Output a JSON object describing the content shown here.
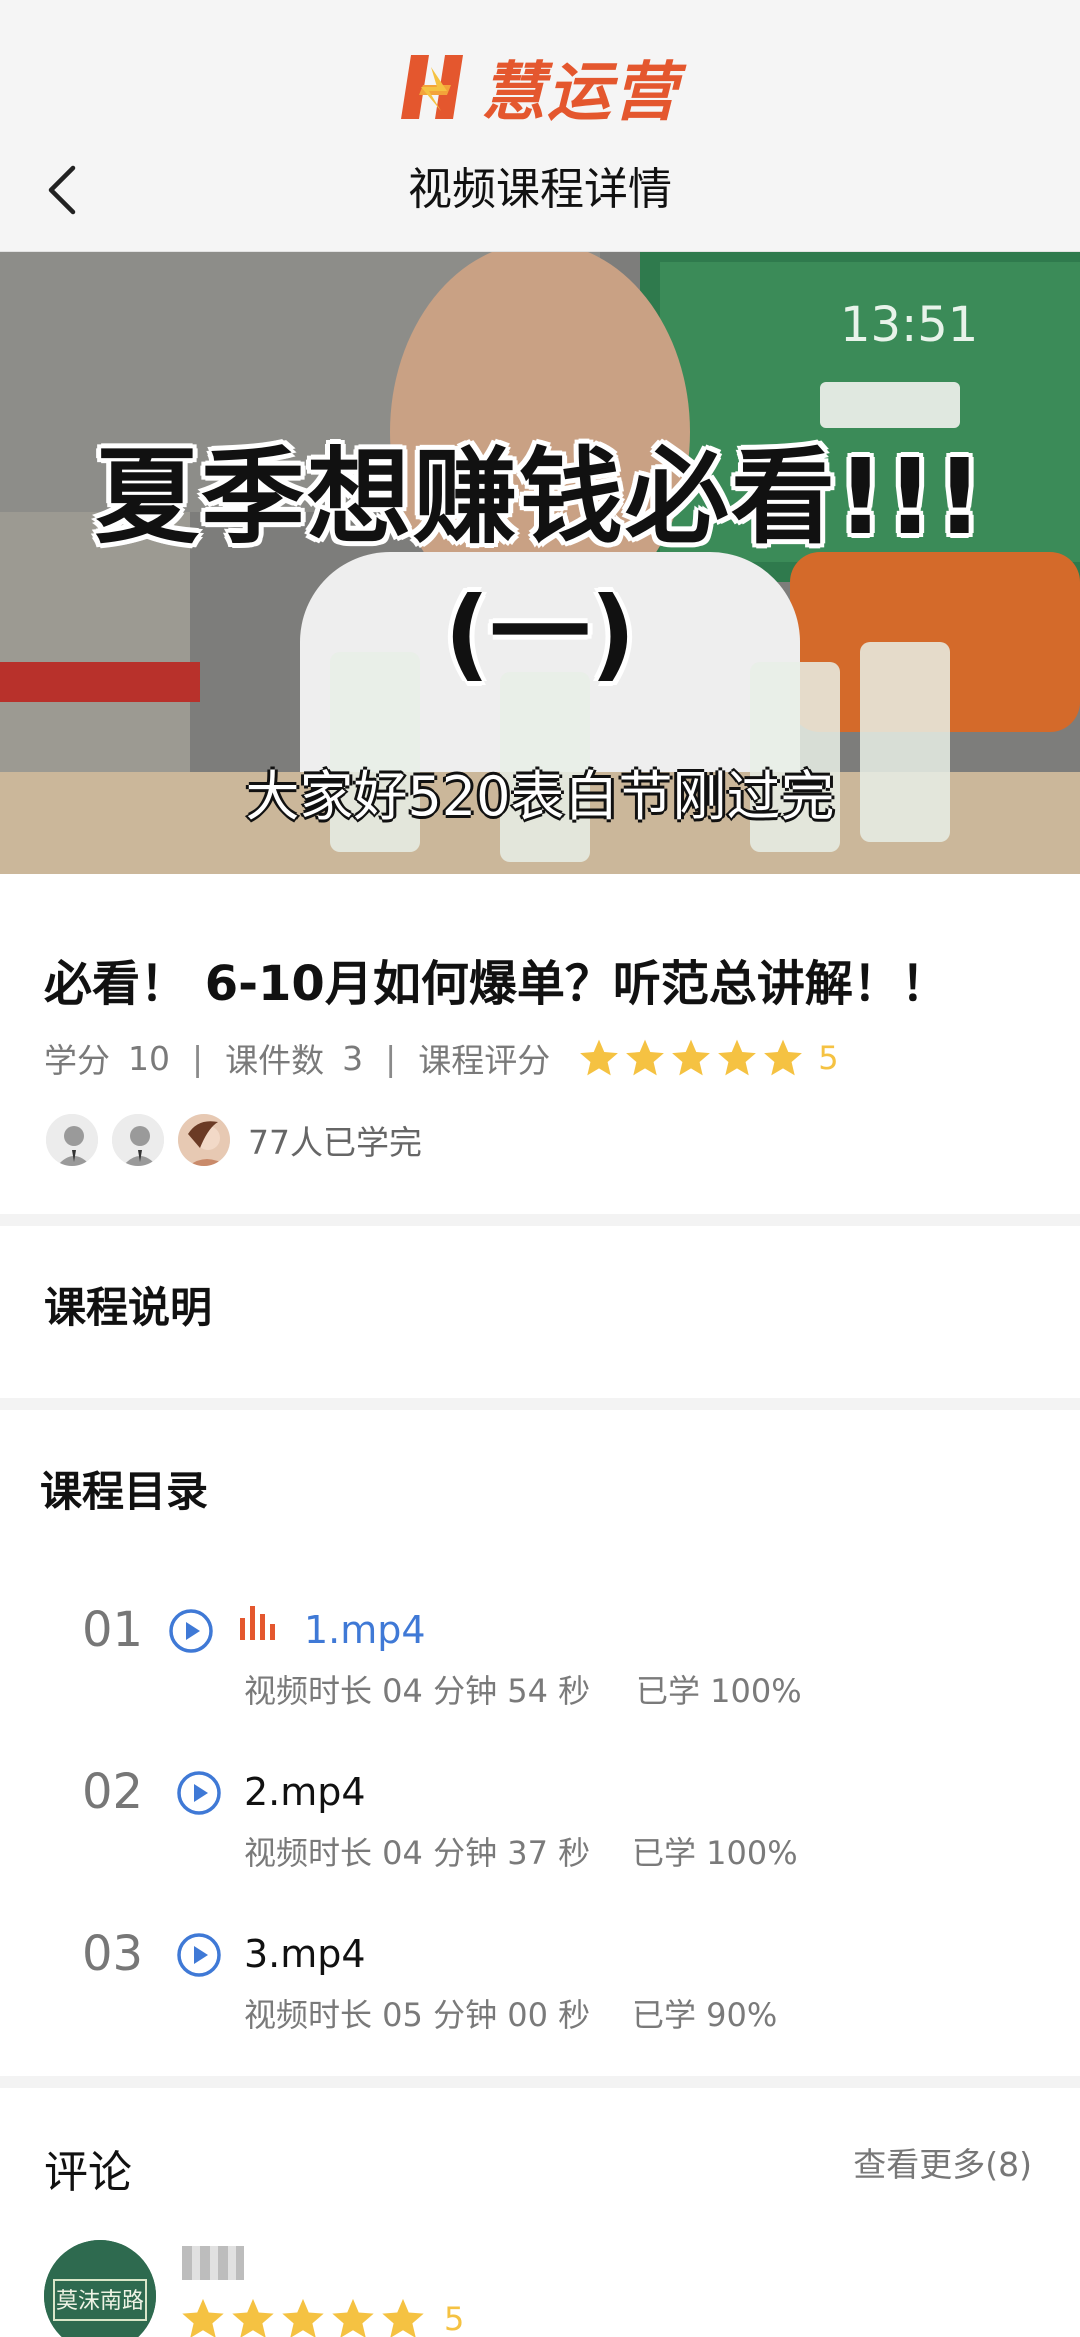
{
  "header": {
    "brand": "慧运营",
    "title": "视频课程详情"
  },
  "video": {
    "caption_main": "夏季想赚钱必看!!!",
    "caption_sub": "(一)",
    "caption_small": "大家好520表白节刚过完",
    "clock": "13:51"
  },
  "course": {
    "title": "必看！ 6-10月如何爆单？听范总讲解！！",
    "credit_label": "学分",
    "credit_value": "10",
    "separator": "|",
    "files_label": "课件数",
    "files_value": "3",
    "rating_label": "课程评分",
    "rating_value": "5",
    "rating_stars": 5,
    "learners_text": "77人已学完"
  },
  "description": {
    "title": "课程说明"
  },
  "catalog": {
    "title": "课程目录",
    "lessons": [
      {
        "num": "01",
        "name": "1.mp4",
        "duration": "视频时长 04 分钟 54 秒",
        "progress": "已学 100%",
        "playing": true
      },
      {
        "num": "02",
        "name": "2.mp4",
        "duration": "视频时长 04 分钟 37 秒",
        "progress": "已学 100%",
        "playing": false
      },
      {
        "num": "03",
        "name": "3.mp4",
        "duration": "视频时长 05 分钟 00 秒",
        "progress": "已学 90%",
        "playing": false
      }
    ]
  },
  "comments": {
    "title": "评论",
    "see_more": "查看更多(8)",
    "first": {
      "rating_value": "5",
      "rating_stars": 5,
      "avatar_text": "莫沫南路"
    }
  },
  "colors": {
    "brand": "#e4572e",
    "active": "#3f79d6",
    "star": "#f5c242"
  }
}
